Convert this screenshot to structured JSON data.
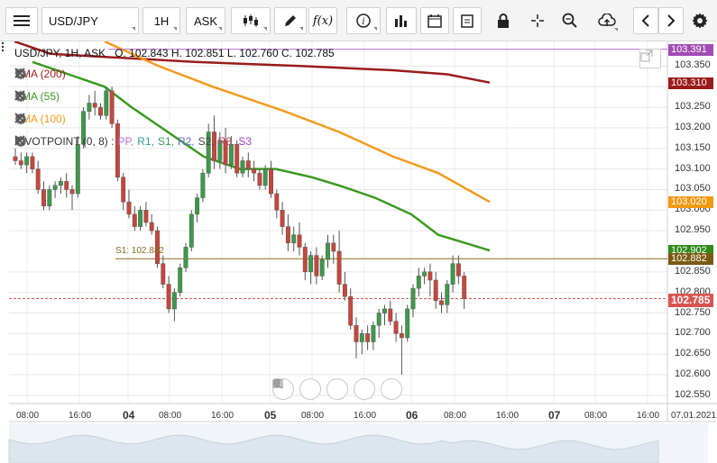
{
  "toolbar": {
    "symbol": "USD/JPY",
    "timeframe": "1H",
    "price_type": "ASK",
    "icons": [
      "menu-icon",
      "candlestick-icon",
      "pencil-icon",
      "function-icon",
      "info-icon",
      "bar-chart-icon",
      "calendar-icon",
      "clipboard-icon",
      "lock-icon",
      "crosshair-icon",
      "zoom-icon",
      "upload-cloud-icon",
      "chevron-left-icon",
      "chevron-right-icon",
      "settings-icon"
    ]
  },
  "chart": {
    "header": "USD/JPY, 1H, ASK",
    "ohlc": "O. 102.843 H. 102.851 L. 102.760 C. 102.785",
    "indicators": [
      {
        "label": "SMA (200)",
        "color": "#9b1b1b"
      },
      {
        "label": "SMA (55)",
        "color": "#3a9a1e"
      },
      {
        "label": "SMA (100)",
        "color": "#f49a1c"
      }
    ],
    "pivot": {
      "prefix": "PIVOTPOINT (0, 8) :",
      "items": [
        {
          "text": "PP,",
          "color": "#b86fd1"
        },
        {
          "text": "R1,",
          "color": "#2f9a9a"
        },
        {
          "text": "S1,",
          "color": "#2f9a5a"
        },
        {
          "text": "R2,",
          "color": "#6a6ad1"
        },
        {
          "text": "S2,",
          "color": "#444444"
        },
        {
          "text": "R3,",
          "color": "#c2476a"
        },
        {
          "text": "S3",
          "color": "#9e3fd1"
        }
      ]
    },
    "s1_label": "S1: 102.882",
    "price_labels": [
      {
        "text": "103.391",
        "color": "#a34bb5",
        "price": 103.391
      },
      {
        "text": "103.310",
        "color": "#9b1b1b",
        "price": 103.31
      },
      {
        "text": "103.020",
        "color": "#f29a12",
        "price": 103.02
      },
      {
        "text": "102.902",
        "color": "#2e8b1a",
        "price": 102.902
      },
      {
        "text": "102.882",
        "color": "#7a5a12",
        "price": 102.882
      },
      {
        "text": "102.785",
        "color": "#d9534f",
        "price": 102.785
      }
    ],
    "y_ticks": [
      "103.350",
      "103.300",
      "103.250",
      "103.200",
      "103.150",
      "103.100",
      "103.050",
      "103.000",
      "102.950",
      "102.850",
      "102.800",
      "102.750",
      "102.700",
      "102.650",
      "102.600",
      "102.550"
    ],
    "x_ticks": [
      {
        "label": "08:00",
        "bold": false
      },
      {
        "label": "16:00",
        "bold": false
      },
      {
        "label": "04",
        "bold": true
      },
      {
        "label": "08:00",
        "bold": false
      },
      {
        "label": "16:00",
        "bold": false
      },
      {
        "label": "05",
        "bold": true
      },
      {
        "label": "08:00",
        "bold": false
      },
      {
        "label": "16:00",
        "bold": false
      },
      {
        "label": "06",
        "bold": true
      },
      {
        "label": "08:00",
        "bold": false
      },
      {
        "label": "16:00",
        "bold": false
      },
      {
        "label": "07",
        "bold": true
      },
      {
        "label": "08:00",
        "bold": false
      },
      {
        "label": "16:00",
        "bold": false
      }
    ],
    "date_corner": "07.01.2021",
    "nav_buttons": [
      "scroll-left",
      "zoom-out",
      "reset",
      "zoom-in",
      "scroll-right"
    ]
  },
  "chart_data": {
    "type": "candlestick",
    "ylim": [
      102.53,
      103.41
    ],
    "last_price": 102.785,
    "candles": [
      [
        103.13,
        103.15,
        103.11,
        103.12
      ],
      [
        103.12,
        103.14,
        103.1,
        103.11
      ],
      [
        103.11,
        103.14,
        103.09,
        103.13
      ],
      [
        103.13,
        103.14,
        103.09,
        103.1
      ],
      [
        103.1,
        103.12,
        103.04,
        103.05
      ],
      [
        103.05,
        103.07,
        103.0,
        103.01
      ],
      [
        103.01,
        103.06,
        103.0,
        103.05
      ],
      [
        103.05,
        103.07,
        103.03,
        103.06
      ],
      [
        103.06,
        103.08,
        103.04,
        103.07
      ],
      [
        103.07,
        103.09,
        103.03,
        103.05
      ],
      [
        103.05,
        103.06,
        103.0,
        103.04
      ],
      [
        103.04,
        103.18,
        103.03,
        103.16
      ],
      [
        103.16,
        103.25,
        103.15,
        103.24
      ],
      [
        103.24,
        103.28,
        103.22,
        103.26
      ],
      [
        103.26,
        103.29,
        103.23,
        103.25
      ],
      [
        103.25,
        103.26,
        103.22,
        103.23
      ],
      [
        103.23,
        103.3,
        103.22,
        103.29
      ],
      [
        103.29,
        103.3,
        103.2,
        103.21
      ],
      [
        103.21,
        103.22,
        103.07,
        103.08
      ],
      [
        103.08,
        103.09,
        103.0,
        103.02
      ],
      [
        103.02,
        103.05,
        102.98,
        102.99
      ],
      [
        102.99,
        103.01,
        102.95,
        102.96
      ],
      [
        102.96,
        103.01,
        102.95,
        103.0
      ],
      [
        103.0,
        103.02,
        102.96,
        102.97
      ],
      [
        102.97,
        102.99,
        102.94,
        102.95
      ],
      [
        102.95,
        102.96,
        102.86,
        102.87
      ],
      [
        102.87,
        102.89,
        102.81,
        102.82
      ],
      [
        102.82,
        102.84,
        102.75,
        102.76
      ],
      [
        102.76,
        102.81,
        102.73,
        102.8
      ],
      [
        102.8,
        102.87,
        102.79,
        102.86
      ],
      [
        102.86,
        102.92,
        102.85,
        102.91
      ],
      [
        102.91,
        103.0,
        102.9,
        102.99
      ],
      [
        102.99,
        103.04,
        102.97,
        103.03
      ],
      [
        103.03,
        103.1,
        103.02,
        103.09
      ],
      [
        103.09,
        103.21,
        103.08,
        103.19
      ],
      [
        103.19,
        103.23,
        103.1,
        103.12
      ],
      [
        103.12,
        103.19,
        103.1,
        103.17
      ],
      [
        103.17,
        103.2,
        103.09,
        103.11
      ],
      [
        103.11,
        103.18,
        103.1,
        103.16
      ],
      [
        103.16,
        103.17,
        103.08,
        103.09
      ],
      [
        103.09,
        103.13,
        103.08,
        103.12
      ],
      [
        103.12,
        103.14,
        103.08,
        103.1
      ],
      [
        103.1,
        103.12,
        103.07,
        103.09
      ],
      [
        103.09,
        103.1,
        103.05,
        103.06
      ],
      [
        103.06,
        103.11,
        103.05,
        103.1
      ],
      [
        103.1,
        103.12,
        103.03,
        103.04
      ],
      [
        103.04,
        103.05,
        102.98,
        103.0
      ],
      [
        103.0,
        103.02,
        102.94,
        102.96
      ],
      [
        102.96,
        102.99,
        102.9,
        102.92
      ],
      [
        102.92,
        102.96,
        102.9,
        102.94
      ],
      [
        102.94,
        102.97,
        102.89,
        102.91
      ],
      [
        102.91,
        102.92,
        102.83,
        102.85
      ],
      [
        102.85,
        102.9,
        102.82,
        102.89
      ],
      [
        102.89,
        102.91,
        102.82,
        102.84
      ],
      [
        102.84,
        102.89,
        102.83,
        102.88
      ],
      [
        102.88,
        102.94,
        102.86,
        102.92
      ],
      [
        102.92,
        102.94,
        102.87,
        102.9
      ],
      [
        102.9,
        102.95,
        102.8,
        102.82
      ],
      [
        102.82,
        102.85,
        102.78,
        102.79
      ],
      [
        102.79,
        102.81,
        102.71,
        102.72
      ],
      [
        102.72,
        102.74,
        102.64,
        102.68
      ],
      [
        102.68,
        102.71,
        102.65,
        102.7
      ],
      [
        102.7,
        102.72,
        102.66,
        102.68
      ],
      [
        102.68,
        102.73,
        102.66,
        102.72
      ],
      [
        102.72,
        102.76,
        102.69,
        102.75
      ],
      [
        102.75,
        102.77,
        102.72,
        102.76
      ],
      [
        102.76,
        102.78,
        102.72,
        102.73
      ],
      [
        102.73,
        102.75,
        102.68,
        102.7
      ],
      [
        102.7,
        102.72,
        102.6,
        102.69
      ],
      [
        102.69,
        102.77,
        102.68,
        102.76
      ],
      [
        102.76,
        102.82,
        102.74,
        102.81
      ],
      [
        102.81,
        102.86,
        102.79,
        102.84
      ],
      [
        102.84,
        102.86,
        102.82,
        102.85
      ],
      [
        102.85,
        102.87,
        102.79,
        102.83
      ],
      [
        102.83,
        102.85,
        102.76,
        102.78
      ],
      [
        102.78,
        102.8,
        102.75,
        102.77
      ],
      [
        102.77,
        102.83,
        102.75,
        102.82
      ],
      [
        102.82,
        102.89,
        102.8,
        102.87
      ],
      [
        102.87,
        102.89,
        102.82,
        102.84
      ],
      [
        102.84,
        102.85,
        102.76,
        102.785
      ]
    ],
    "sma_200": [
      [
        0,
        103.41
      ],
      [
        40,
        103.38
      ],
      [
        120,
        103.37
      ],
      [
        200,
        103.36
      ],
      [
        320,
        103.35
      ],
      [
        420,
        103.34
      ],
      [
        480,
        103.33
      ],
      [
        527,
        103.31
      ]
    ],
    "sma_100": [
      [
        100,
        103.41
      ],
      [
        160,
        103.35
      ],
      [
        220,
        103.3
      ],
      [
        300,
        103.24
      ],
      [
        360,
        103.19
      ],
      [
        420,
        103.13
      ],
      [
        470,
        103.09
      ],
      [
        527,
        103.02
      ]
    ],
    "sma_55": [
      [
        20,
        103.36
      ],
      [
        60,
        103.33
      ],
      [
        100,
        103.3
      ],
      [
        130,
        103.25
      ],
      [
        170,
        103.19
      ],
      [
        210,
        103.13
      ],
      [
        250,
        103.1
      ],
      [
        290,
        103.1
      ],
      [
        330,
        103.08
      ],
      [
        360,
        103.06
      ],
      [
        400,
        103.03
      ],
      [
        440,
        102.99
      ],
      [
        470,
        102.94
      ],
      [
        500,
        102.92
      ],
      [
        527,
        102.902
      ]
    ],
    "s1_price": 102.882
  }
}
